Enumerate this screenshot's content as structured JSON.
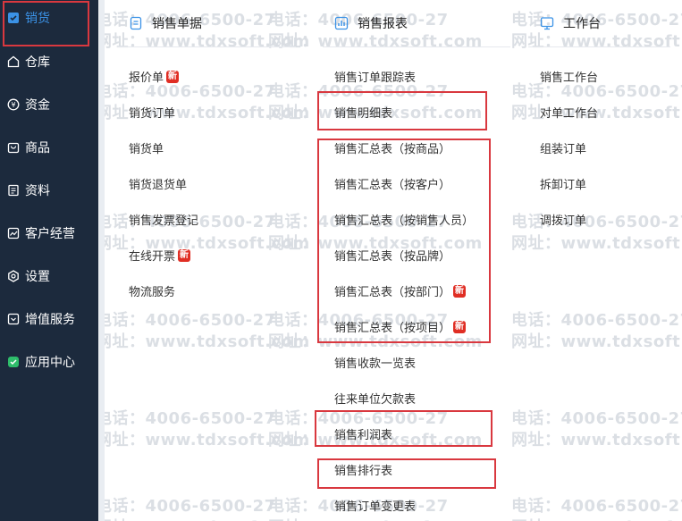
{
  "sidebar": {
    "items": [
      {
        "label": "销货",
        "icon": "sales-icon",
        "active": true
      },
      {
        "label": "仓库",
        "icon": "warehouse-icon"
      },
      {
        "label": "资金",
        "icon": "funds-icon"
      },
      {
        "label": "商品",
        "icon": "goods-icon"
      },
      {
        "label": "资料",
        "icon": "data-icon"
      },
      {
        "label": "客户经营",
        "icon": "customer-ops-icon"
      },
      {
        "label": "设置",
        "icon": "settings-icon"
      },
      {
        "label": "增值服务",
        "icon": "value-added-icon"
      },
      {
        "label": "应用中心",
        "icon": "app-center-icon"
      }
    ],
    "accent": "#3b92e6",
    "bg": "#1c2a3d"
  },
  "columns": [
    {
      "title": "销售单据",
      "icon": "document-icon",
      "items": [
        {
          "label": "报价单",
          "badge": "新"
        },
        {
          "label": "销货订单"
        },
        {
          "label": "销货单"
        },
        {
          "label": "销货退货单"
        },
        {
          "label": "销售发票登记"
        },
        {
          "label": "在线开票",
          "badge": "新"
        },
        {
          "label": "物流服务"
        }
      ]
    },
    {
      "title": "销售报表",
      "icon": "report-chart-icon",
      "items": [
        {
          "label": "销售订单跟踪表"
        },
        {
          "label": "销售明细表"
        },
        {
          "label": "销售汇总表（按商品）"
        },
        {
          "label": "销售汇总表（按客户）"
        },
        {
          "label": "销售汇总表（按销售人员）"
        },
        {
          "label": "销售汇总表（按品牌）"
        },
        {
          "label": "销售汇总表（按部门）",
          "badge": "新"
        },
        {
          "label": "销售汇总表（按项目）",
          "badge": "新"
        },
        {
          "label": "销售收款一览表"
        },
        {
          "label": "往来单位欠款表"
        },
        {
          "label": "销售利润表"
        },
        {
          "label": "销售排行表"
        },
        {
          "label": "销售订单变更表"
        }
      ]
    },
    {
      "title": "工作台",
      "icon": "workbench-icon",
      "items": [
        {
          "label": "销售工作台"
        },
        {
          "label": "对单工作台"
        },
        {
          "label": "组装订单"
        },
        {
          "label": "拆卸订单"
        },
        {
          "label": "调拨订单"
        }
      ]
    }
  ],
  "watermark": {
    "phone": "电话：4006-6500-27",
    "site": "网址：www.tdxsoft.com"
  },
  "colors": {
    "badge": "#e02e24",
    "highlight_box": "#d9383f"
  }
}
